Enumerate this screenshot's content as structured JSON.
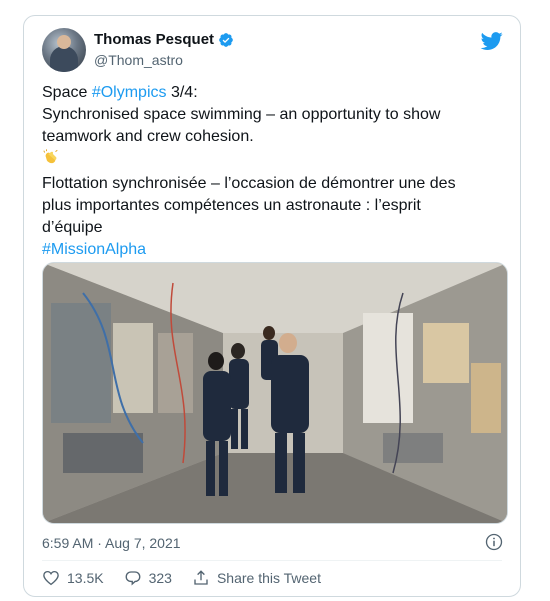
{
  "author": {
    "display_name": "Thomas Pesquet",
    "handle": "@Thom_astro"
  },
  "tweet": {
    "line1_prefix": "Space ",
    "line1_hashtag": "#Olympics",
    "line1_suffix": " 3/4:",
    "line2": "Synchronised space swimming – an opportunity to show",
    "line3": "teamwork and crew cohesion.",
    "line4": "Flottation synchronisée – l’occasion de démontrer une des",
    "line5": "plus importantes compétences un astronaute : l’esprit",
    "line6": "d’équipe",
    "hashtag_mission": "#MissionAlpha"
  },
  "timestamp": "6:59 AM · Aug 7, 2021",
  "actions": {
    "likes": "13.5K",
    "replies": "323",
    "share_label": "Share this Tweet"
  },
  "colors": {
    "accent": "#1d9bf0",
    "secondary_text": "#536471",
    "border": "#cfd9de"
  }
}
